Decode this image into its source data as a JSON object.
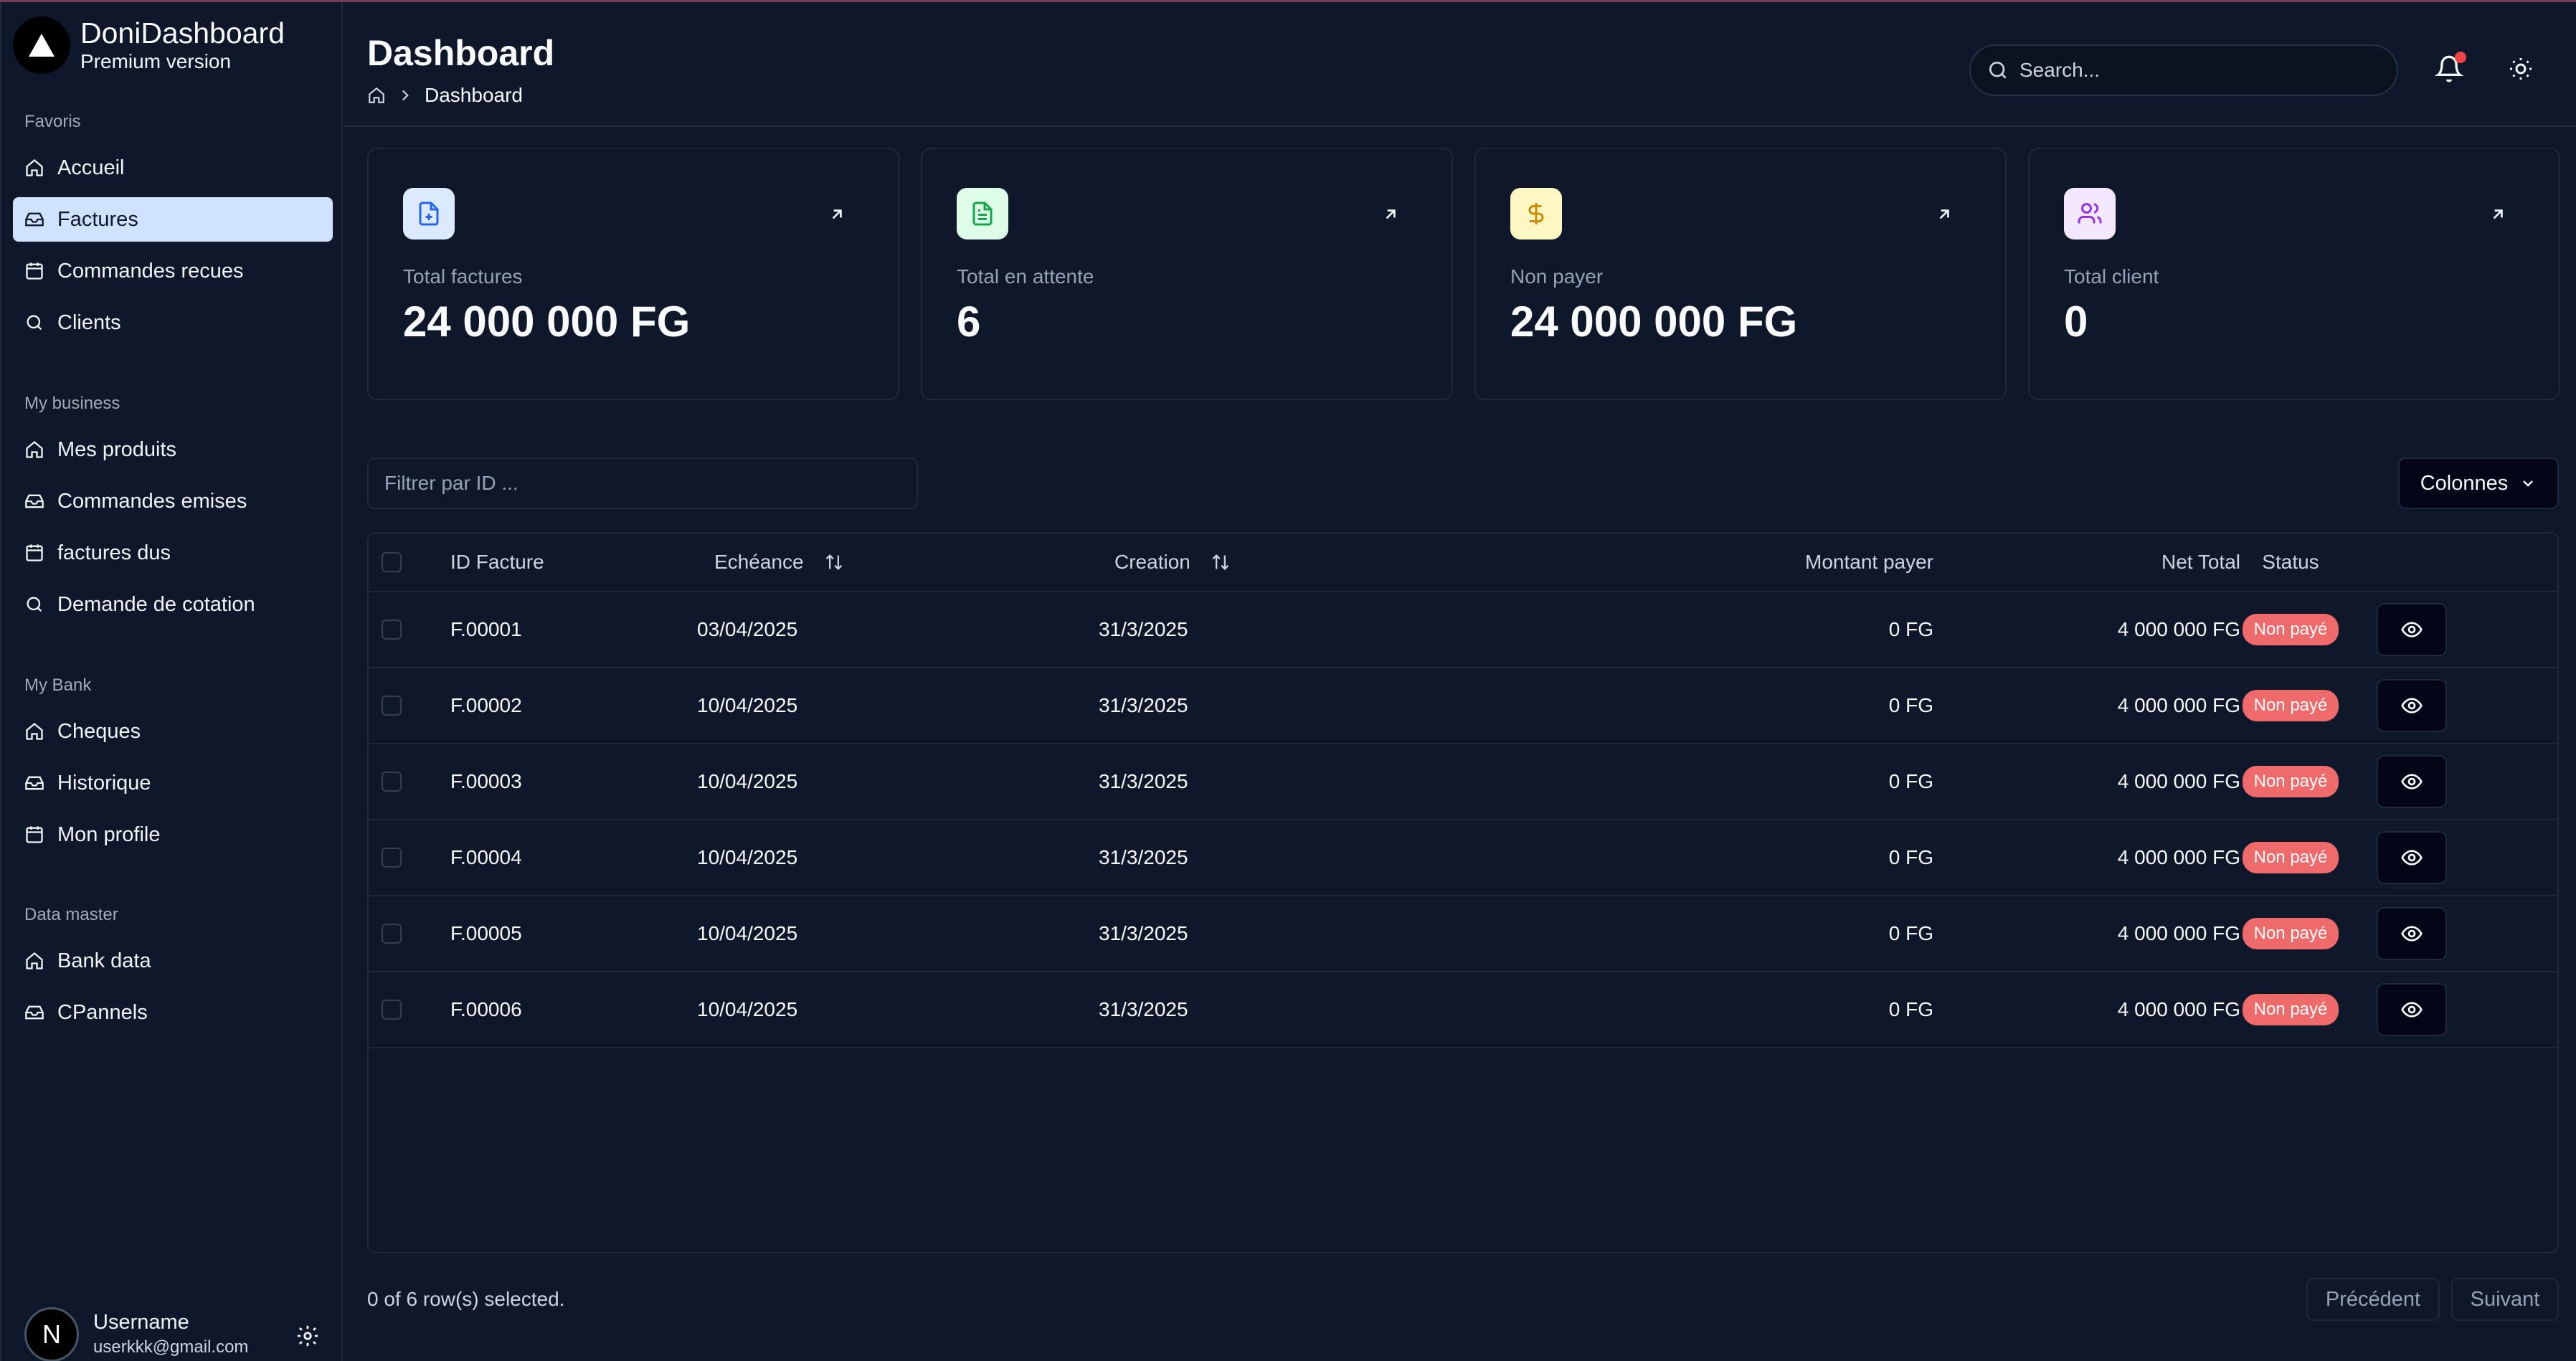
{
  "brand": {
    "title": "DoniDashboard",
    "subtitle": "Premium version"
  },
  "sidebar": {
    "groups": [
      {
        "label": "Favoris",
        "items": [
          {
            "label": "Accueil",
            "icon": "home-icon"
          },
          {
            "label": "Factures",
            "icon": "inbox-icon",
            "active": true
          },
          {
            "label": "Commandes recues",
            "icon": "calendar-icon"
          },
          {
            "label": "Clients",
            "icon": "search-icon"
          }
        ]
      },
      {
        "label": "My business",
        "items": [
          {
            "label": "Mes produits",
            "icon": "home-icon"
          },
          {
            "label": "Commandes emises",
            "icon": "inbox-icon"
          },
          {
            "label": "factures dus",
            "icon": "calendar-icon"
          },
          {
            "label": "Demande de cotation",
            "icon": "search-icon"
          }
        ]
      },
      {
        "label": "My Bank",
        "items": [
          {
            "label": "Cheques",
            "icon": "home-icon"
          },
          {
            "label": "Historique",
            "icon": "inbox-icon"
          },
          {
            "label": "Mon profile",
            "icon": "calendar-icon"
          }
        ]
      },
      {
        "label": "Data master",
        "items": [
          {
            "label": "Bank data",
            "icon": "home-icon"
          },
          {
            "label": "CPannels",
            "icon": "inbox-icon"
          }
        ]
      }
    ],
    "user": {
      "initial": "N",
      "name": "Username",
      "email": "userkkk@gmail.com"
    }
  },
  "header": {
    "title": "Dashboard",
    "breadcrumb": "Dashboard",
    "search_placeholder": "Search..."
  },
  "stats": [
    {
      "label": "Total factures",
      "value": "24 000 000 FG",
      "icon": "file-plus-icon",
      "icon_bg": "#dbeafe",
      "icon_color": "#2563eb"
    },
    {
      "label": "Total en attente",
      "value": "6",
      "icon": "file-text-icon",
      "icon_bg": "#dcfce7",
      "icon_color": "#16a34a"
    },
    {
      "label": "Non payer",
      "value": "24 000 000 FG",
      "icon": "dollar-icon",
      "icon_bg": "#fef9c3",
      "icon_color": "#ca8a04"
    },
    {
      "label": "Total client",
      "value": "0",
      "icon": "users-icon",
      "icon_bg": "#f3e8ff",
      "icon_color": "#9333ea"
    }
  ],
  "filter": {
    "placeholder": "Filtrer par ID ..."
  },
  "columns_button": "Colonnes",
  "table": {
    "headers": {
      "id": "ID Facture",
      "due": "Echéance",
      "created": "Creation",
      "paid": "Montant payer",
      "net": "Net Total",
      "status": "Status"
    },
    "rows": [
      {
        "id": "F.00001",
        "due": "03/04/2025",
        "created": "31/3/2025",
        "paid": "0 FG",
        "net": "4 000 000 FG",
        "status": "Non payé"
      },
      {
        "id": "F.00002",
        "due": "10/04/2025",
        "created": "31/3/2025",
        "paid": "0 FG",
        "net": "4 000 000 FG",
        "status": "Non payé"
      },
      {
        "id": "F.00003",
        "due": "10/04/2025",
        "created": "31/3/2025",
        "paid": "0 FG",
        "net": "4 000 000 FG",
        "status": "Non payé"
      },
      {
        "id": "F.00004",
        "due": "10/04/2025",
        "created": "31/3/2025",
        "paid": "0 FG",
        "net": "4 000 000 FG",
        "status": "Non payé"
      },
      {
        "id": "F.00005",
        "due": "10/04/2025",
        "created": "31/3/2025",
        "paid": "0 FG",
        "net": "4 000 000 FG",
        "status": "Non payé"
      },
      {
        "id": "F.00006",
        "due": "10/04/2025",
        "created": "31/3/2025",
        "paid": "0 FG",
        "net": "4 000 000 FG",
        "status": "Non payé"
      }
    ]
  },
  "footer": {
    "selection_text": "0 of 6 row(s) selected.",
    "prev_label": "Précédent",
    "next_label": "Suivant"
  },
  "colors": {
    "active_nav": "#cfe2ff",
    "badge": "#ef6b6b",
    "notification_dot": "#ef4444"
  }
}
